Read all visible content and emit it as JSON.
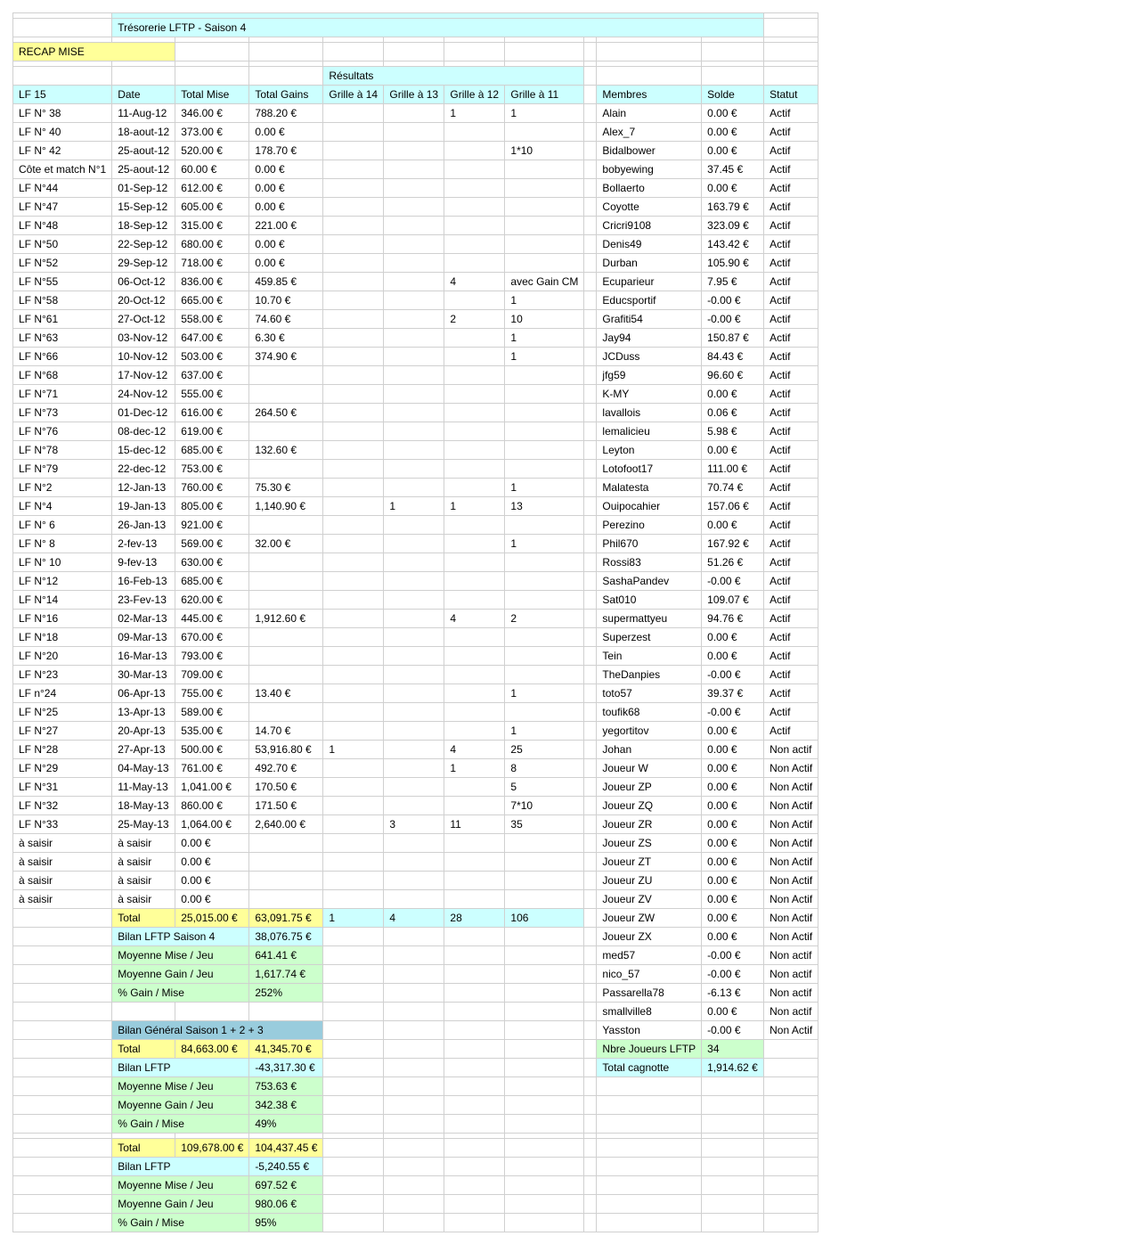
{
  "title": "Trésorerie LFTP - Saison 4",
  "recap_label": "RECAP MISE",
  "resultats_label": "Résultats",
  "headers": {
    "lf": "LF 15",
    "date": "Date",
    "mise": "Total Mise",
    "gains": "Total Gains",
    "g14": "Grille à 14",
    "g13": "Grille à 13",
    "g12": "Grille à 12",
    "g11": "Grille à 11",
    "membres": "Membres",
    "solde": "Solde",
    "statut": "Statut"
  },
  "rows": [
    [
      "LF N° 38",
      "11-Aug-12",
      "346.00 €",
      "788.20 €",
      "",
      "",
      "1",
      "1"
    ],
    [
      "LF N° 40",
      "18-aout-12",
      "373.00 €",
      "0.00 €",
      "",
      "",
      "",
      ""
    ],
    [
      "LF N° 42",
      "25-aout-12",
      "520.00 €",
      "178.70 €",
      "",
      "",
      "",
      "1*10"
    ],
    [
      "Côte et match N°1",
      "25-aout-12",
      "60.00 €",
      "0.00 €",
      "",
      "",
      "",
      ""
    ],
    [
      "LF N°44",
      "01-Sep-12",
      "612.00 €",
      "0.00 €",
      "",
      "",
      "",
      ""
    ],
    [
      "LF N°47",
      "15-Sep-12",
      "605.00 €",
      "0.00 €",
      "",
      "",
      "",
      ""
    ],
    [
      "LF N°48",
      "18-Sep-12",
      "315.00 €",
      "221.00 €",
      "",
      "",
      "",
      ""
    ],
    [
      "LF N°50",
      "22-Sep-12",
      "680.00 €",
      "0.00 €",
      "",
      "",
      "",
      ""
    ],
    [
      "LF N°52",
      "29-Sep-12",
      "718.00 €",
      "0.00 €",
      "",
      "",
      "",
      ""
    ],
    [
      "LF N°55",
      "06-Oct-12",
      "836.00 €",
      "459.85 €",
      "",
      "",
      "4",
      "avec Gain CM"
    ],
    [
      "LF N°58",
      "20-Oct-12",
      "665.00 €",
      "10.70 €",
      "",
      "",
      "",
      "1"
    ],
    [
      "LF N°61",
      "27-Oct-12",
      "558.00 €",
      "74.60 €",
      "",
      "",
      "2",
      "10"
    ],
    [
      "LF N°63",
      "03-Nov-12",
      "647.00 €",
      "6.30 €",
      "",
      "",
      "",
      "1"
    ],
    [
      "LF N°66",
      "10-Nov-12",
      "503.00 €",
      "374.90 €",
      "",
      "",
      "",
      "1"
    ],
    [
      "LF N°68",
      "17-Nov-12",
      "637.00 €",
      "",
      "",
      "",
      "",
      ""
    ],
    [
      "LF N°71",
      "24-Nov-12",
      "555.00 €",
      "",
      "",
      "",
      "",
      ""
    ],
    [
      "LF N°73",
      "01-Dec-12",
      "616.00 €",
      "264.50 €",
      "",
      "",
      "",
      ""
    ],
    [
      "LF N°76",
      "08-dec-12",
      "619.00 €",
      "",
      "",
      "",
      "",
      ""
    ],
    [
      "LF N°78",
      "15-dec-12",
      "685.00 €",
      "132.60 €",
      "",
      "",
      "",
      ""
    ],
    [
      "LF N°79",
      "22-dec-12",
      "753.00 €",
      "",
      "",
      "",
      "",
      ""
    ],
    [
      "LF N°2",
      "12-Jan-13",
      "760.00 €",
      "75.30 €",
      "",
      "",
      "",
      "1"
    ],
    [
      "LF N°4",
      "19-Jan-13",
      "805.00 €",
      "1,140.90 €",
      "",
      "1",
      "1",
      "13"
    ],
    [
      "LF N° 6",
      "26-Jan-13",
      "921.00 €",
      "",
      "",
      "",
      "",
      ""
    ],
    [
      "LF N° 8",
      "2-fev-13",
      "569.00 €",
      "32.00 €",
      "",
      "",
      "",
      "1"
    ],
    [
      "LF N° 10",
      "9-fev-13",
      "630.00 €",
      "",
      "",
      "",
      "",
      ""
    ],
    [
      "LF N°12",
      "16-Feb-13",
      "685.00 €",
      "",
      "",
      "",
      "",
      ""
    ],
    [
      "LF N°14",
      "23-Fev-13",
      "620.00 €",
      "",
      "",
      "",
      "",
      ""
    ],
    [
      "LF N°16",
      "02-Mar-13",
      "445.00 €",
      "1,912.60 €",
      "",
      "",
      "4",
      "2"
    ],
    [
      "LF N°18",
      "09-Mar-13",
      "670.00 €",
      "",
      "",
      "",
      "",
      ""
    ],
    [
      "LF N°20",
      "16-Mar-13",
      "793.00 €",
      "",
      "",
      "",
      "",
      ""
    ],
    [
      "LF N°23",
      "30-Mar-13",
      "709.00 €",
      "",
      "",
      "",
      "",
      ""
    ],
    [
      "LF n°24",
      "06-Apr-13",
      "755.00 €",
      "13.40 €",
      "",
      "",
      "",
      "1"
    ],
    [
      "LF N°25",
      "13-Apr-13",
      "589.00 €",
      "",
      "",
      "",
      "",
      ""
    ],
    [
      "LF N°27",
      "20-Apr-13",
      "535.00 €",
      "14.70 €",
      "",
      "",
      "",
      "1"
    ],
    [
      "LF N°28",
      "27-Apr-13",
      "500.00 €",
      "53,916.80 €",
      "1",
      "",
      "4",
      "25"
    ],
    [
      "LF N°29",
      "04-May-13",
      "761.00 €",
      "492.70 €",
      "",
      "",
      "1",
      "8"
    ],
    [
      "LF N°31",
      "11-May-13",
      "1,041.00 €",
      "170.50 €",
      "",
      "",
      "",
      "5"
    ],
    [
      "LF N°32",
      "18-May-13",
      "860.00 €",
      "171.50 €",
      "",
      "",
      "",
      "7*10"
    ],
    [
      "LF N°33",
      "25-May-13",
      "1,064.00 €",
      "2,640.00 €",
      "",
      "3",
      "11",
      "35"
    ],
    [
      "à saisir",
      "à saisir",
      "0.00 €",
      "",
      "",
      "",
      "",
      ""
    ],
    [
      "à saisir",
      "à saisir",
      "0.00 €",
      "",
      "",
      "",
      "",
      ""
    ],
    [
      "à saisir",
      "à saisir",
      "0.00 €",
      "",
      "",
      "",
      "",
      ""
    ],
    [
      "à saisir",
      "à saisir",
      "0.00 €",
      "",
      "",
      "",
      "",
      ""
    ]
  ],
  "members": [
    [
      "Alain",
      "0.00 €",
      "Actif"
    ],
    [
      "Alex_7",
      "0.00 €",
      "Actif"
    ],
    [
      "Bidalbower",
      "0.00 €",
      "Actif"
    ],
    [
      "bobyewing",
      "37.45 €",
      "Actif"
    ],
    [
      "Bollaerto",
      "0.00 €",
      "Actif"
    ],
    [
      "Coyotte",
      "163.79 €",
      "Actif"
    ],
    [
      "Cricri9108",
      "323.09 €",
      "Actif"
    ],
    [
      "Denis49",
      "143.42 €",
      "Actif"
    ],
    [
      "Durban",
      "105.90 €",
      "Actif"
    ],
    [
      "Ecuparieur",
      "7.95 €",
      "Actif"
    ],
    [
      "Educsportif",
      "-0.00 €",
      "Actif"
    ],
    [
      "Grafiti54",
      "-0.00 €",
      "Actif"
    ],
    [
      "Jay94",
      "150.87 €",
      "Actif"
    ],
    [
      "JCDuss",
      "84.43 €",
      "Actif"
    ],
    [
      "jfg59",
      "96.60 €",
      "Actif"
    ],
    [
      "K-MY",
      "0.00 €",
      "Actif"
    ],
    [
      "lavallois",
      "0.06 €",
      "Actif"
    ],
    [
      "lemalicieu",
      "5.98 €",
      "Actif"
    ],
    [
      "Leyton",
      "0.00 €",
      "Actif"
    ],
    [
      "Lotofoot17",
      "111.00 €",
      "Actif"
    ],
    [
      "Malatesta",
      "70.74 €",
      "Actif"
    ],
    [
      "Ouipocahier",
      "157.06 €",
      "Actif"
    ],
    [
      "Perezino",
      "0.00 €",
      "Actif"
    ],
    [
      "Phil670",
      "167.92 €",
      "Actif"
    ],
    [
      "Rossi83",
      "51.26 €",
      "Actif"
    ],
    [
      "SashaPandev",
      "-0.00 €",
      "Actif"
    ],
    [
      "Sat010",
      "109.07 €",
      "Actif"
    ],
    [
      "supermattyeu",
      "94.76 €",
      "Actif"
    ],
    [
      "Superzest",
      "0.00 €",
      "Actif"
    ],
    [
      "Tein",
      "0.00 €",
      "Actif"
    ],
    [
      "TheDanpies",
      "-0.00 €",
      "Actif"
    ],
    [
      "toto57",
      "39.37 €",
      "Actif"
    ],
    [
      "toufik68",
      "-0.00 €",
      "Actif"
    ],
    [
      "yegortitov",
      "0.00 €",
      "Actif"
    ],
    [
      "Johan",
      "0.00 €",
      "Non actif"
    ],
    [
      "Joueur W",
      "0.00 €",
      "Non Actif"
    ],
    [
      "Joueur ZP",
      "0.00 €",
      "Non Actif"
    ],
    [
      "Joueur ZQ",
      "0.00 €",
      "Non Actif"
    ],
    [
      "Joueur ZR",
      "0.00 €",
      "Non Actif"
    ],
    [
      "Joueur ZS",
      "0.00 €",
      "Non Actif"
    ],
    [
      "Joueur ZT",
      "0.00 €",
      "Non Actif"
    ],
    [
      "Joueur ZU",
      "0.00 €",
      "Non Actif"
    ],
    [
      "Joueur ZV",
      "0.00 €",
      "Non Actif"
    ],
    [
      "Joueur ZW",
      "0.00 €",
      "Non Actif"
    ],
    [
      "Joueur ZX",
      "0.00 €",
      "Non Actif"
    ],
    [
      "med57",
      "-0.00 €",
      "Non actif"
    ],
    [
      "nico_57",
      "-0.00 €",
      "Non actif"
    ],
    [
      "Passarella78",
      "-6.13 €",
      "Non actif"
    ],
    [
      "smallville8",
      "0.00 €",
      "Non actif"
    ],
    [
      "Yasston",
      "-0.00 €",
      "Non Actif"
    ]
  ],
  "totals_row": {
    "label": "Total",
    "mise": "25,015.00 €",
    "gains": "63,091.75 €",
    "g14": "1",
    "g13": "4",
    "g12": "28",
    "g11": "106"
  },
  "season": {
    "bilan_label": "Bilan LFTP Saison 4",
    "bilan_value": "38,076.75 €",
    "moy_mise_label": "Moyenne Mise / Jeu",
    "moy_mise_value": "641.41 €",
    "moy_gain_label": "Moyenne Gain / Jeu",
    "moy_gain_value": "1,617.74 €",
    "pct_label": "% Gain / Mise",
    "pct_value": "252%"
  },
  "general": {
    "title": "Bilan Général Saison 1 + 2 + 3",
    "total_label": "Total",
    "total_mise": "84,663.00 €",
    "total_gains": "41,345.70 €",
    "bilan_label": "Bilan LFTP",
    "bilan_value": "-43,317.30 €",
    "moy_mise_label": "Moyenne Mise / Jeu",
    "moy_mise_value": "753.63 €",
    "moy_gain_label": "Moyenne Gain / Jeu",
    "moy_gain_value": "342.38 €",
    "pct_label": "% Gain / Mise",
    "pct_value": "49%"
  },
  "grand": {
    "total_label": "Total",
    "total_mise": "109,678.00 €",
    "total_gains": "104,437.45 €",
    "bilan_label": "Bilan LFTP",
    "bilan_value": "-5,240.55 €",
    "moy_mise_label": "Moyenne Mise / Jeu",
    "moy_mise_value": "697.52 €",
    "moy_gain_label": "Moyenne Gain / Jeu",
    "moy_gain_value": "980.06 €",
    "pct_label": "% Gain / Mise",
    "pct_value": "95%"
  },
  "summary": {
    "nbre_label": "Nbre Joueurs LFTP",
    "nbre_value": "34",
    "cagnotte_label": "Total cagnotte",
    "cagnotte_value": "1,914.62 €"
  }
}
